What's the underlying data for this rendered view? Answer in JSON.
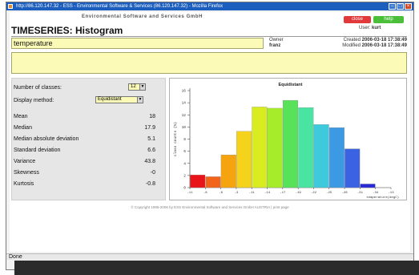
{
  "browser": {
    "title": "http://86.120.147.32 - ESS - Environmental Software & Services (86.120.147.32) - Mozilla Firefox",
    "status": "Done"
  },
  "header": {
    "company": "Environmental Software and Services GmbH",
    "close_label": "close",
    "help_label": "help",
    "user_label": "User:",
    "user_name": "kurt"
  },
  "page": {
    "title": "TIMESERIES: Histogram",
    "name_value": "temperature",
    "owner_label": "Owner",
    "owner_value": "franz",
    "created_label": "Created",
    "created_value": "2006-03-18 17:38:49",
    "modified_label": "Modified",
    "modified_value": "2006-03-18 17:38:49"
  },
  "controls": {
    "classes_label": "Number of classes:",
    "classes_value": "12",
    "display_label": "Display method:",
    "display_value": "Equidistant"
  },
  "stats": [
    {
      "label": "Mean",
      "value": "18"
    },
    {
      "label": "Median",
      "value": "17.9"
    },
    {
      "label": "Median absolute deviation",
      "value": "5.1"
    },
    {
      "label": "Standard deviation",
      "value": "6.6"
    },
    {
      "label": "Variance",
      "value": "43.8"
    },
    {
      "label": "Skewness",
      "value": "-0"
    },
    {
      "label": "Kurtosis",
      "value": "-0.8"
    }
  ],
  "footer": "© Copyright 1995-2006 by   ESS   Environmental Software and Services GmbH AUSTRIA | print page",
  "chart_data": {
    "type": "bar",
    "title": "Equidistant",
    "xlabel": "temperature(degC)",
    "ylabel": "class counts (%)",
    "ylim": [
      0,
      16
    ],
    "yticks": [
      0,
      2,
      4,
      6,
      8,
      10,
      12,
      14,
      16
    ],
    "categories": [
      "-11",
      "-8",
      "-6",
      "-3",
      "-11",
      "-14",
      "-17",
      "-19",
      "-22",
      "-25",
      "-28",
      "-31",
      "-34",
      "-13"
    ],
    "values": [
      2.1,
      1.8,
      5.4,
      9.3,
      13.3,
      13.1,
      14.4,
      13.2,
      10.4,
      9.9,
      6.4,
      0.6,
      0
    ],
    "colors": [
      "#e8141a",
      "#f2641a",
      "#f5a410",
      "#f5d21c",
      "#d8ec20",
      "#a6ec2a",
      "#58e25a",
      "#4ae4a2",
      "#3ecadc",
      "#3c9ae4",
      "#3c62e4",
      "#2a2ad4",
      "#1a1aa0"
    ],
    "grid": false
  }
}
